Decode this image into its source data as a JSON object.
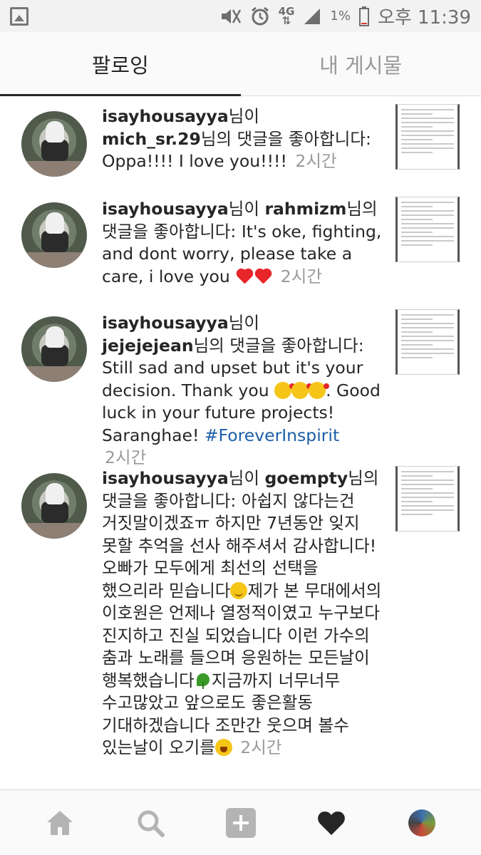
{
  "status_bar": {
    "network": "4G",
    "battery": "1%",
    "time": "오후 11:39"
  },
  "tabs": [
    {
      "label": "팔로잉",
      "active": true
    },
    {
      "label": "내 게시물",
      "active": false
    }
  ],
  "activity": [
    {
      "user": "isayhousayya",
      "prefix_suffix": "님이",
      "target": "mich_sr.29",
      "target_suffix": "님의",
      "action": "댓글을 좋아합니다:",
      "comment": "Oppa!!!! I love you!!!!",
      "time": "2시간"
    },
    {
      "user": "isayhousayya",
      "prefix_suffix": "님이",
      "target": "rahmizm",
      "target_suffix": "님의",
      "action": "댓글을 좋아합니다:",
      "comment": "It's oke, fighting, and dont worry, please take a care, i love you",
      "time": "2시간"
    },
    {
      "user": "isayhousayya",
      "prefix_suffix": "님이",
      "target": "jejejejean",
      "target_suffix": "님의",
      "action": "댓글을 좋아합니다:",
      "comment_a": "Still sad and upset but it's your decision. Thank you",
      "comment_b": ". Good luck in your future projects! Saranghae!",
      "hashtag": "#ForeverInspirit",
      "time": "2시간"
    },
    {
      "user": "isayhousayya",
      "prefix_suffix": "님이",
      "target": "goempty",
      "target_suffix": "님의",
      "action": "댓글을 좋아합니다:",
      "comment_a": "아쉽지 않다는건 거짓말이겠죠ㅠ 하지만 7년동안 잊지 못할 추억을 선사 해주셔서 감사합니다! 오빠가 모두에게 최선의 선택을 했으리라 믿습니다",
      "comment_b": "제가 본 무대에서의 이호원은 언제나 열정적이였고 누구보다 진지하고 진실 되었습니다 이런 가수의 춤과 노래를 들으며 응원하는 모든날이 행복했습니다",
      "comment_c": "지금까지 너무너무 수고많았고 앞으로도 좋은활동 기대하겠습니다 조만간 웃으며 볼수 있는날이 오기를",
      "time": "2시간"
    }
  ],
  "nav": {
    "items": [
      "home-icon",
      "search-icon",
      "add-icon",
      "heart-icon",
      "profile-avatar"
    ]
  }
}
